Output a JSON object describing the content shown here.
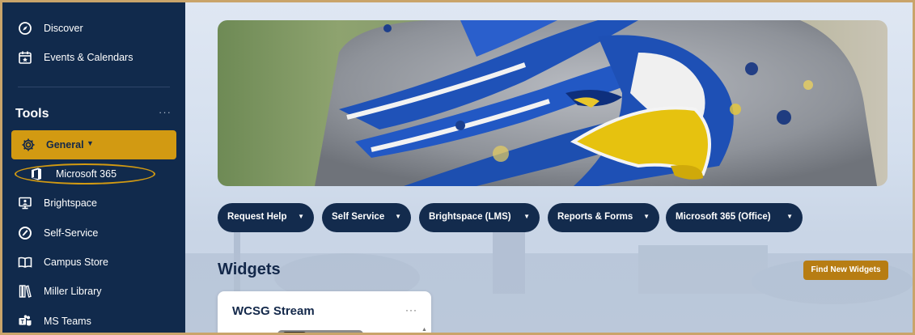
{
  "sidebar": {
    "top_items": [
      {
        "label": "Discover",
        "icon": "compass-icon"
      },
      {
        "label": "Events & Calendars",
        "icon": "calendar-star-icon"
      }
    ],
    "tools": {
      "title": "Tools",
      "more": "···",
      "general": {
        "label": "General",
        "caret": "▼",
        "icon": "gear-icon"
      },
      "items": [
        {
          "label": "Microsoft 365",
          "icon": "office-icon"
        },
        {
          "label": "Brightspace",
          "icon": "monitor-icon"
        },
        {
          "label": "Self-Service",
          "icon": "self-service-icon"
        },
        {
          "label": "Campus Store",
          "icon": "book-open-icon"
        },
        {
          "label": "Miller Library",
          "icon": "library-icon"
        },
        {
          "label": "MS Teams",
          "icon": "teams-icon"
        }
      ]
    }
  },
  "quick_links": [
    {
      "label": "Request Help",
      "caret": "▼"
    },
    {
      "label": "Self Service",
      "caret": "▼"
    },
    {
      "label": "Brightspace (LMS)",
      "caret": "▼"
    },
    {
      "label": "Reports & Forms",
      "caret": "▼"
    },
    {
      "label": "Microsoft 365 (Office)",
      "caret": "▼"
    }
  ],
  "widgets": {
    "title": "Widgets",
    "find_button": "Find New Widgets",
    "card": {
      "title": "WCSG Stream",
      "more": "···",
      "scroll": "▲"
    }
  },
  "colors": {
    "sidebar_bg": "#112a4c",
    "accent_gold": "#d29a12",
    "button_navy": "#132b4d",
    "find_button": "#b77d13"
  }
}
